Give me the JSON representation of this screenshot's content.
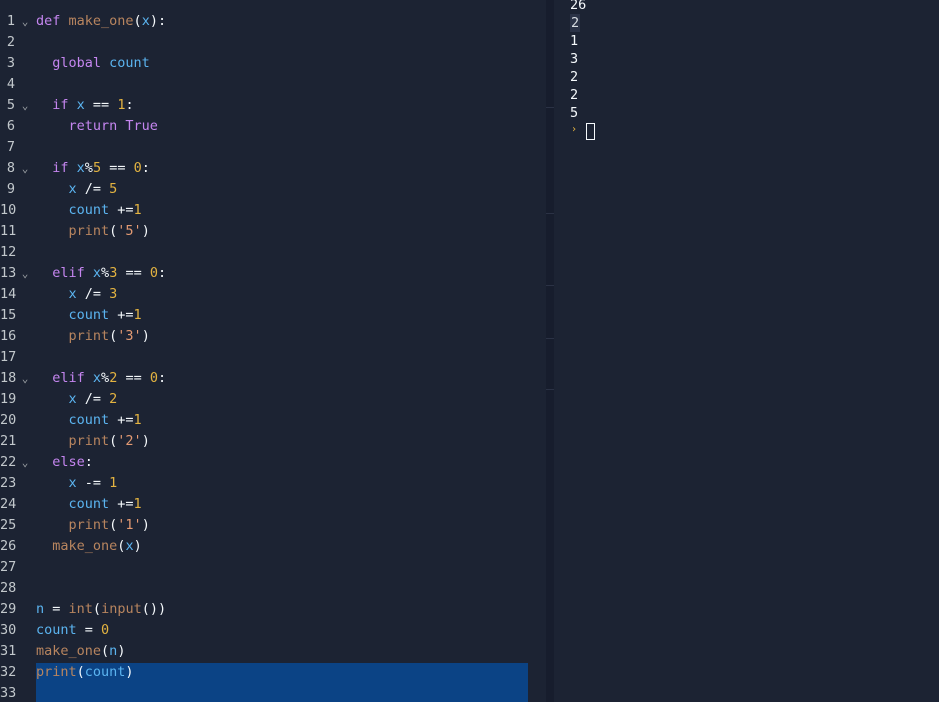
{
  "editor": {
    "lines": [
      {
        "n": "1",
        "fold": true,
        "tokens": [
          [
            "kw",
            "def "
          ],
          [
            "fn",
            "make_one"
          ],
          [
            "plain",
            "("
          ],
          [
            "var",
            "x"
          ],
          [
            "plain",
            "):"
          ]
        ]
      },
      {
        "n": "2",
        "fold": false,
        "tokens": []
      },
      {
        "n": "3",
        "fold": false,
        "tokens": [
          [
            "plain",
            "  "
          ],
          [
            "kw",
            "global "
          ],
          [
            "var",
            "count"
          ]
        ]
      },
      {
        "n": "4",
        "fold": false,
        "tokens": []
      },
      {
        "n": "5",
        "fold": true,
        "tokens": [
          [
            "plain",
            "  "
          ],
          [
            "kw",
            "if "
          ],
          [
            "var",
            "x"
          ],
          [
            "plain",
            " == "
          ],
          [
            "num",
            "1"
          ],
          [
            "plain",
            ":"
          ]
        ]
      },
      {
        "n": "6",
        "fold": false,
        "tokens": [
          [
            "plain",
            "    "
          ],
          [
            "kw",
            "return "
          ],
          [
            "kw",
            "True"
          ]
        ]
      },
      {
        "n": "7",
        "fold": false,
        "tokens": []
      },
      {
        "n": "8",
        "fold": true,
        "tokens": [
          [
            "plain",
            "  "
          ],
          [
            "kw",
            "if "
          ],
          [
            "var",
            "x"
          ],
          [
            "plain",
            "%"
          ],
          [
            "num",
            "5"
          ],
          [
            "plain",
            " == "
          ],
          [
            "num",
            "0"
          ],
          [
            "plain",
            ":"
          ]
        ]
      },
      {
        "n": "9",
        "fold": false,
        "tokens": [
          [
            "plain",
            "    "
          ],
          [
            "var",
            "x"
          ],
          [
            "plain",
            " /= "
          ],
          [
            "num",
            "5"
          ]
        ]
      },
      {
        "n": "10",
        "fold": false,
        "tokens": [
          [
            "plain",
            "    "
          ],
          [
            "var",
            "count"
          ],
          [
            "plain",
            " +="
          ],
          [
            "num",
            "1"
          ]
        ]
      },
      {
        "n": "11",
        "fold": false,
        "tokens": [
          [
            "plain",
            "    "
          ],
          [
            "fn",
            "print"
          ],
          [
            "plain",
            "("
          ],
          [
            "str",
            "'5'"
          ],
          [
            "plain",
            ")"
          ]
        ]
      },
      {
        "n": "12",
        "fold": false,
        "tokens": []
      },
      {
        "n": "13",
        "fold": true,
        "tokens": [
          [
            "plain",
            "  "
          ],
          [
            "kw",
            "elif "
          ],
          [
            "var",
            "x"
          ],
          [
            "plain",
            "%"
          ],
          [
            "num",
            "3"
          ],
          [
            "plain",
            " == "
          ],
          [
            "num",
            "0"
          ],
          [
            "plain",
            ":"
          ]
        ]
      },
      {
        "n": "14",
        "fold": false,
        "tokens": [
          [
            "plain",
            "    "
          ],
          [
            "var",
            "x"
          ],
          [
            "plain",
            " /= "
          ],
          [
            "num",
            "3"
          ]
        ]
      },
      {
        "n": "15",
        "fold": false,
        "tokens": [
          [
            "plain",
            "    "
          ],
          [
            "var",
            "count"
          ],
          [
            "plain",
            " +="
          ],
          [
            "num",
            "1"
          ]
        ]
      },
      {
        "n": "16",
        "fold": false,
        "tokens": [
          [
            "plain",
            "    "
          ],
          [
            "fn",
            "print"
          ],
          [
            "plain",
            "("
          ],
          [
            "str",
            "'3'"
          ],
          [
            "plain",
            ")"
          ]
        ]
      },
      {
        "n": "17",
        "fold": false,
        "tokens": []
      },
      {
        "n": "18",
        "fold": true,
        "tokens": [
          [
            "plain",
            "  "
          ],
          [
            "kw",
            "elif "
          ],
          [
            "var",
            "x"
          ],
          [
            "plain",
            "%"
          ],
          [
            "num",
            "2"
          ],
          [
            "plain",
            " == "
          ],
          [
            "num",
            "0"
          ],
          [
            "plain",
            ":"
          ]
        ]
      },
      {
        "n": "19",
        "fold": false,
        "tokens": [
          [
            "plain",
            "    "
          ],
          [
            "var",
            "x"
          ],
          [
            "plain",
            " /= "
          ],
          [
            "num",
            "2"
          ]
        ]
      },
      {
        "n": "20",
        "fold": false,
        "tokens": [
          [
            "plain",
            "    "
          ],
          [
            "var",
            "count"
          ],
          [
            "plain",
            " +="
          ],
          [
            "num",
            "1"
          ]
        ]
      },
      {
        "n": "21",
        "fold": false,
        "tokens": [
          [
            "plain",
            "    "
          ],
          [
            "fn",
            "print"
          ],
          [
            "plain",
            "("
          ],
          [
            "str",
            "'2'"
          ],
          [
            "plain",
            ")"
          ]
        ]
      },
      {
        "n": "22",
        "fold": true,
        "tokens": [
          [
            "plain",
            "  "
          ],
          [
            "kw",
            "else"
          ],
          [
            "plain",
            ":"
          ]
        ]
      },
      {
        "n": "23",
        "fold": false,
        "tokens": [
          [
            "plain",
            "    "
          ],
          [
            "var",
            "x"
          ],
          [
            "plain",
            " -= "
          ],
          [
            "num",
            "1"
          ]
        ]
      },
      {
        "n": "24",
        "fold": false,
        "tokens": [
          [
            "plain",
            "    "
          ],
          [
            "var",
            "count"
          ],
          [
            "plain",
            " +="
          ],
          [
            "num",
            "1"
          ]
        ]
      },
      {
        "n": "25",
        "fold": false,
        "tokens": [
          [
            "plain",
            "    "
          ],
          [
            "fn",
            "print"
          ],
          [
            "plain",
            "("
          ],
          [
            "str",
            "'1'"
          ],
          [
            "plain",
            ")"
          ]
        ]
      },
      {
        "n": "26",
        "fold": false,
        "tokens": [
          [
            "plain",
            "  "
          ],
          [
            "fn",
            "make_one"
          ],
          [
            "plain",
            "("
          ],
          [
            "var",
            "x"
          ],
          [
            "plain",
            ")"
          ]
        ]
      },
      {
        "n": "27",
        "fold": false,
        "tokens": []
      },
      {
        "n": "28",
        "fold": false,
        "tokens": []
      },
      {
        "n": "29",
        "fold": false,
        "tokens": [
          [
            "var",
            "n"
          ],
          [
            "plain",
            " = "
          ],
          [
            "fn",
            "int"
          ],
          [
            "plain",
            "("
          ],
          [
            "fn",
            "input"
          ],
          [
            "plain",
            "())"
          ]
        ]
      },
      {
        "n": "30",
        "fold": false,
        "tokens": [
          [
            "var",
            "count"
          ],
          [
            "plain",
            " = "
          ],
          [
            "num",
            "0"
          ]
        ]
      },
      {
        "n": "31",
        "fold": false,
        "tokens": [
          [
            "fn",
            "make_one"
          ],
          [
            "plain",
            "("
          ],
          [
            "var",
            "n"
          ],
          [
            "plain",
            ")"
          ]
        ]
      },
      {
        "n": "32",
        "fold": false,
        "tokens": [
          [
            "fn",
            "print"
          ],
          [
            "plain",
            "("
          ],
          [
            "var",
            "count"
          ],
          [
            "plain",
            ")"
          ]
        ]
      },
      {
        "n": "33",
        "fold": false,
        "tokens": []
      }
    ],
    "fold_glyph": "⌄"
  },
  "console": {
    "output": [
      "26",
      "2",
      "1",
      "3",
      "2",
      "2",
      "5"
    ],
    "prompt_icon": "›"
  },
  "colors": {
    "background": "#1c2333",
    "keyword": "#c586f0",
    "function": "#b8855f",
    "variable": "#5bb4f0",
    "number": "#e3b341",
    "string": "#e39a73",
    "selection": "#0b4385"
  }
}
